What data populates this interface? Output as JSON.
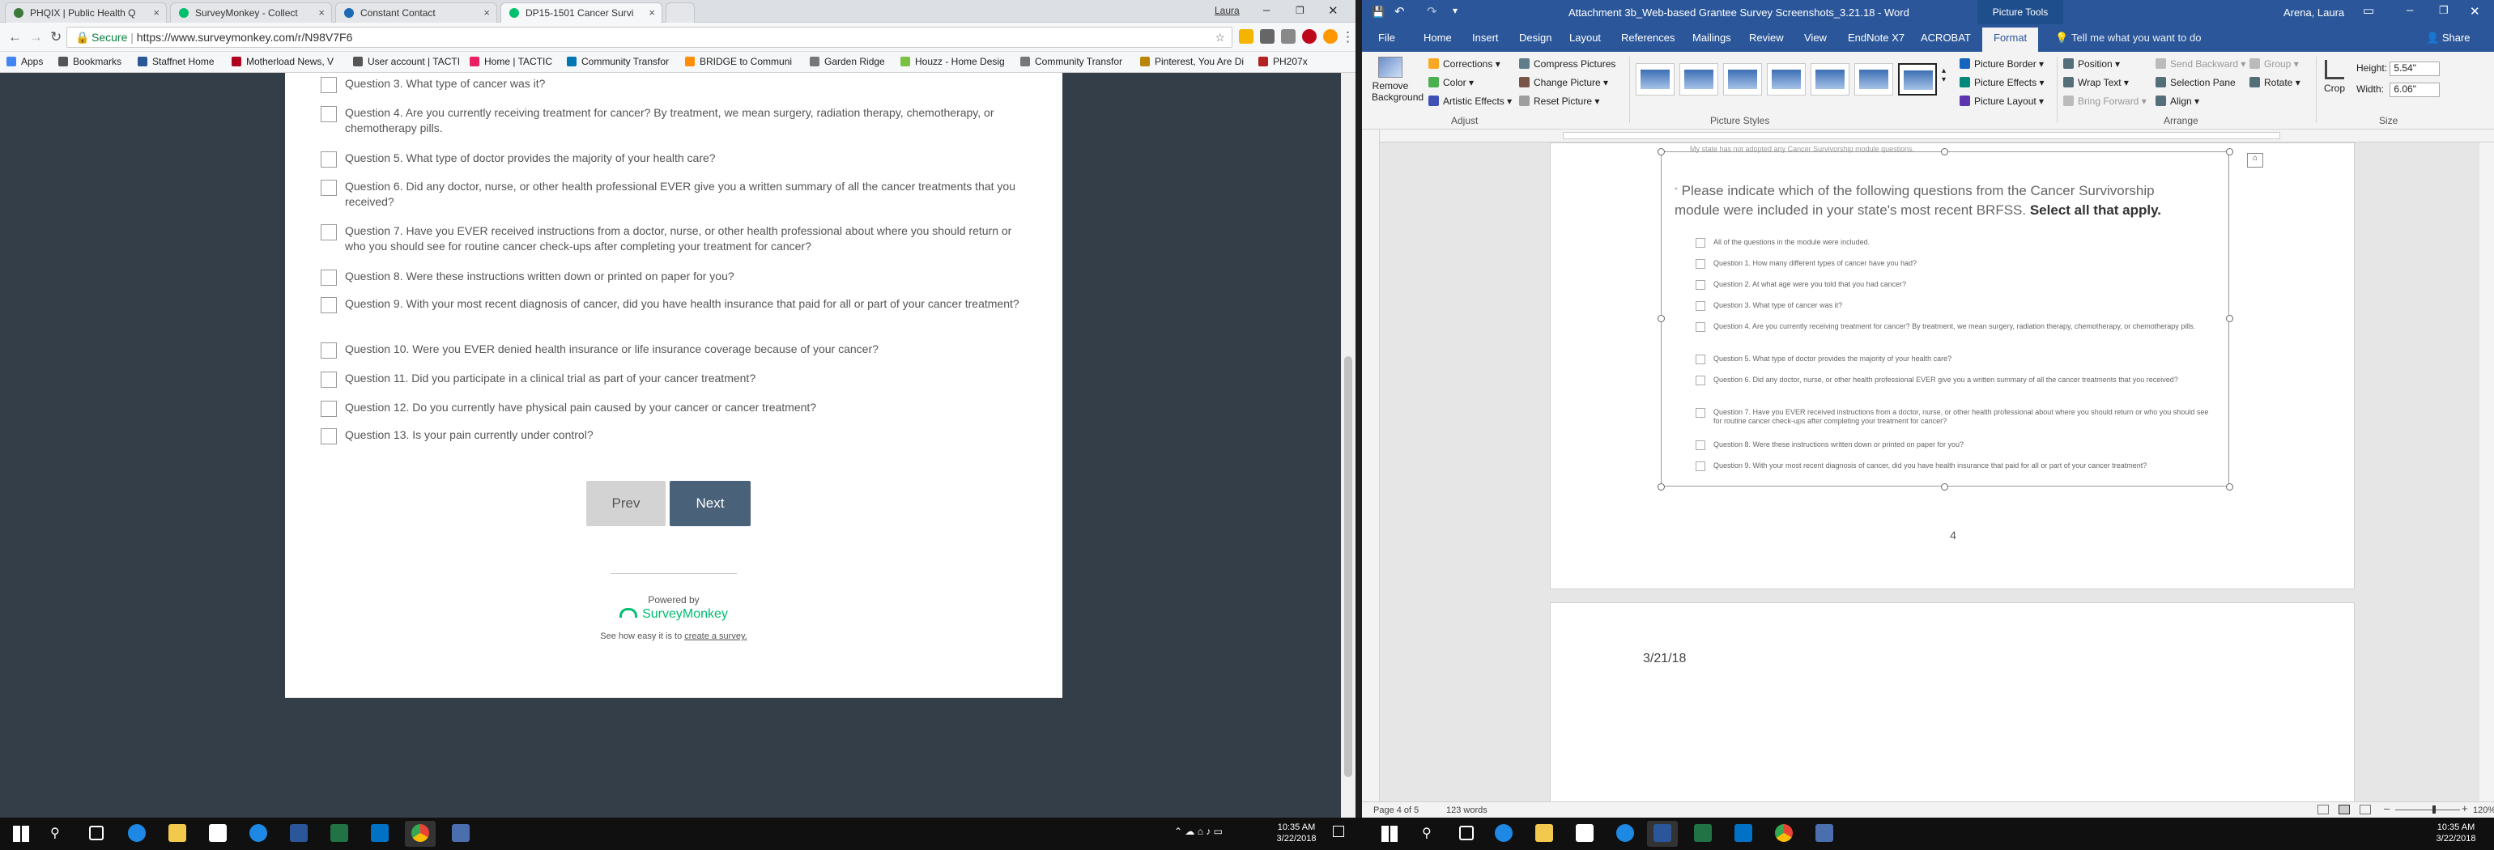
{
  "browser": {
    "tabs": [
      {
        "label": "PHQIX | Public Health Q",
        "color": "#3b7a3b"
      },
      {
        "label": "SurveyMonkey - Collect",
        "color": "#00bf6f"
      },
      {
        "label": "Constant Contact",
        "color": "#1c6ab6"
      },
      {
        "label": "DP15-1501 Cancer Survi",
        "color": "#00bf6f"
      }
    ],
    "user": "Laura",
    "secure_label": "Secure",
    "url": "https://www.surveymonkey.com/r/N98V7F6",
    "bookmarks": [
      {
        "label": "Apps",
        "color": "#4285f4"
      },
      {
        "label": "Bookmarks",
        "color": "#555555"
      },
      {
        "label": "Staffnet Home",
        "color": "#2b5797"
      },
      {
        "label": "Motherload News, V",
        "color": "#b00020"
      },
      {
        "label": "User account | TACTI",
        "color": "#555555"
      },
      {
        "label": "Home | TACTIC",
        "color": "#e91e63"
      },
      {
        "label": "Community Transfor",
        "color": "#0077b5"
      },
      {
        "label": "BRIDGE to Communi",
        "color": "#ff8f00"
      },
      {
        "label": "Garden Ridge",
        "color": "#777777"
      },
      {
        "label": "Houzz - Home Desig",
        "color": "#7ac142"
      },
      {
        "label": "Community Transfor",
        "color": "#777777"
      },
      {
        "label": "Pinterest, You Are Di",
        "color": "#b8860b"
      },
      {
        "label": "PH207x",
        "color": "#b22222"
      }
    ]
  },
  "survey": {
    "questions": [
      "Question 3. What type of cancer was it?",
      "Question 4. Are you currently receiving treatment for cancer? By treatment, we mean surgery, radiation therapy, chemotherapy, or chemotherapy pills.",
      "Question 5. What type of doctor provides the majority of your health care?",
      "Question 6. Did any doctor, nurse, or other health professional EVER give you a written summary of all the cancer treatments that you received?",
      "Question 7. Have you EVER received instructions from a doctor, nurse, or other health professional about where you should return or who you should see for routine cancer check-ups after completing your treatment for cancer?",
      "Question 8. Were these instructions written down or printed on paper for you?",
      "Question 9. With your most recent diagnosis of cancer, did you have health insurance that paid for all or part of your cancer treatment?",
      "Question 10. Were you EVER denied health insurance or life insurance coverage because of your cancer?",
      "Question 11. Did you participate in a clinical trial as part of your cancer treatment?",
      "Question 12. Do you currently have physical pain caused by your cancer or cancer treatment?",
      "Question 13. Is your pain currently under control?"
    ],
    "prev_label": "Prev",
    "next_label": "Next",
    "powered_by": "Powered by",
    "brand": "SurveyMonkey",
    "footer_text": "See how easy it is to",
    "footer_link": "create a survey."
  },
  "word": {
    "title": "Attachment 3b_Web-based Grantee Survey Screenshots_3.21.18 - Word",
    "picture_tools": "Picture Tools",
    "user": "Arena, Laura",
    "tabs": [
      "File",
      "Home",
      "Insert",
      "Design",
      "Layout",
      "References",
      "Mailings",
      "Review",
      "View",
      "EndNote X7",
      "ACROBAT",
      "Format"
    ],
    "tell_me": "Tell me what you want to do",
    "share": "Share",
    "ribbon": {
      "remove_bg": "Remove Background",
      "corrections": "Corrections",
      "color": "Color",
      "artistic": "Artistic Effects",
      "compress": "Compress Pictures",
      "change": "Change Picture",
      "reset": "Reset Picture",
      "adjust": "Adjust",
      "picture_styles": "Picture Styles",
      "border": "Picture Border",
      "effects": "Picture Effects",
      "layout": "Picture Layout",
      "position": "Position",
      "wrap": "Wrap Text",
      "bring": "Bring Forward",
      "send": "Send Backward",
      "selection": "Selection Pane",
      "align": "Align",
      "group": "Group",
      "rotate": "Rotate",
      "arrange": "Arrange",
      "crop": "Crop",
      "height_label": "Height:",
      "height": "5.54\"",
      "width_label": "Width:",
      "width": "6.06\"",
      "size": "Size"
    },
    "doc": {
      "cut_line": "My state has not adopted any Cancer Survivorship module questions.",
      "prompt": "Please indicate which of the following questions from the Cancer Survivorship module were included in your state's most recent BRFSS.",
      "prompt_bold": "Select all that apply.",
      "options": [
        "All of the questions in the module were included.",
        "Question 1. How many different types of cancer have you had?",
        "Question 2. At what age were you told that you had cancer?",
        "Question 3. What type of cancer was it?",
        "Question 4. Are you currently receiving treatment for cancer? By treatment, we mean surgery, radiation therapy, chemotherapy, or chemotherapy pills.",
        "Question 5. What type of doctor provides the majority of your health care?",
        "Question 6. Did any doctor, nurse, or other health professional EVER give you a written summary of all the cancer treatments that you received?",
        "Question 7. Have you EVER received instructions from a doctor, nurse, or other health professional about where you should return or who you should see for routine cancer check-ups after completing your treatment for cancer?",
        "Question 8. Were these instructions written down or printed on paper for you?",
        "Question 9. With your most recent diagnosis of cancer, did you have health insurance that paid for all or part of your cancer treatment?"
      ],
      "page_number": "4",
      "date": "3/21/18"
    },
    "status": {
      "page": "Page 4 of 5",
      "words": "123 words",
      "zoom": "120%"
    }
  },
  "taskbar": {
    "time": "10:35 AM",
    "date": "3/22/2018"
  }
}
